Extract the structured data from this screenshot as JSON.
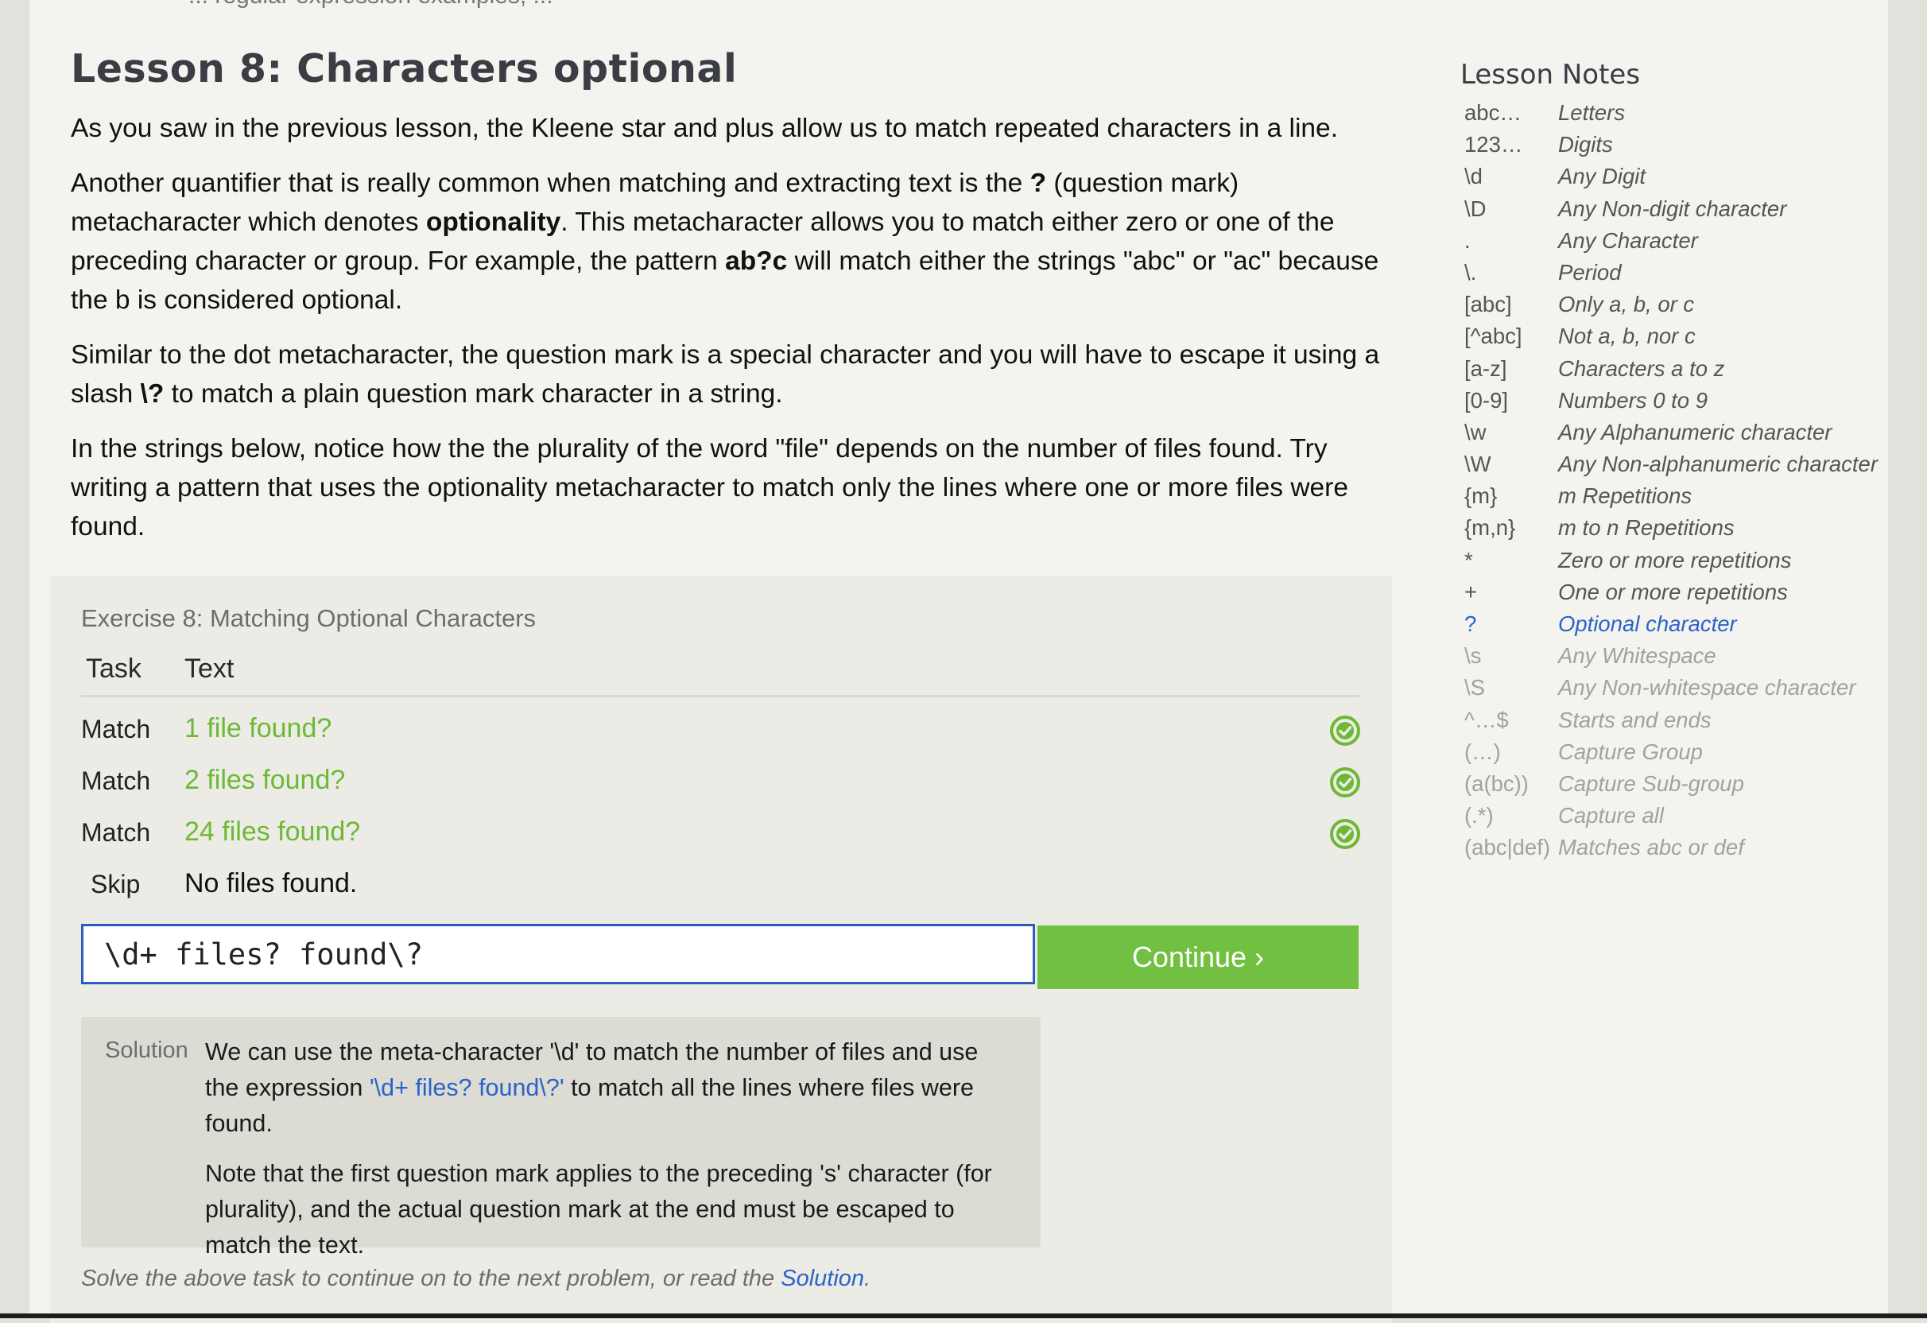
{
  "cutoff_text": "... regular expression examples; ...",
  "lesson": {
    "title": "Lesson 8: Characters optional",
    "p1": "As you saw in the previous lesson, the Kleene star and plus allow us to match repeated characters in a line.",
    "p2_a": "Another quantifier that is really common when matching and extracting text is the ",
    "p2_b": "?",
    "p2_c": " (question mark) metacharacter which denotes ",
    "p2_d": "optionality",
    "p2_e": ". This metacharacter allows you to match either zero or one of the preceding character or group. For example, the pattern ",
    "p2_f": "ab?c",
    "p2_g": " will match either the strings \"abc\" or \"ac\" because the b is considered optional.",
    "p3_a": "Similar to the dot metacharacter, the question mark is a special character and you will have to escape it using a slash ",
    "p3_b": "\\?",
    "p3_c": " to match a plain question mark character in a string.",
    "p4": "In the strings below, notice how the the plurality of the word \"file\" depends on the number of files found. Try writing a pattern that uses the optionality metacharacter to match only the lines where one or more files were found."
  },
  "exercise": {
    "title": "Exercise 8: Matching Optional Characters",
    "col_task": "Task",
    "col_text": "Text",
    "rows": [
      {
        "task": "Match",
        "text": "1 file found?",
        "status": "matched"
      },
      {
        "task": "Match",
        "text": "2 files found?",
        "status": "matched"
      },
      {
        "task": "Match",
        "text": "24 files found?",
        "status": "matched"
      },
      {
        "task": "Skip",
        "text": "No files found.",
        "status": "none"
      }
    ],
    "input_value": "\\d+ files? found\\?",
    "continue_label": "Continue",
    "continue_chevron": "›",
    "solution_label": "Solution",
    "solution_a": "We can use the meta-character '\\d' to match the number of files and use the expression ",
    "solution_code": "'\\d+ files? found\\?'",
    "solution_b": " to match all the lines where files were found.",
    "solution_p2": "Note that the first question mark applies to the preceding 's' character (for plurality), and the actual question mark at the end must be escaped to match the text.",
    "footer_a": "Solve the above task to continue on to the next problem, or read the ",
    "footer_link": "Solution",
    "footer_b": "."
  },
  "notes": {
    "title": "Lesson Notes",
    "items": [
      {
        "sym": "abc…",
        "desc": "Letters",
        "state": "normal"
      },
      {
        "sym": "123…",
        "desc": "Digits",
        "state": "normal"
      },
      {
        "sym": "\\d",
        "desc": "Any Digit",
        "state": "normal"
      },
      {
        "sym": "\\D",
        "desc": "Any Non-digit character",
        "state": "normal"
      },
      {
        "sym": ".",
        "desc": "Any Character",
        "state": "normal"
      },
      {
        "sym": "\\.",
        "desc": "Period",
        "state": "normal"
      },
      {
        "sym": "[abc]",
        "desc": "Only a, b, or c",
        "state": "normal"
      },
      {
        "sym": "[^abc]",
        "desc": "Not a, b, nor c",
        "state": "normal"
      },
      {
        "sym": "[a-z]",
        "desc": "Characters a to z",
        "state": "normal"
      },
      {
        "sym": "[0-9]",
        "desc": "Numbers 0 to 9",
        "state": "normal"
      },
      {
        "sym": "\\w",
        "desc": "Any Alphanumeric character",
        "state": "normal"
      },
      {
        "sym": "\\W",
        "desc": "Any Non-alphanumeric character",
        "state": "normal"
      },
      {
        "sym": "{m}",
        "desc": "m Repetitions",
        "state": "normal"
      },
      {
        "sym": "{m,n}",
        "desc": "m to n Repetitions",
        "state": "normal"
      },
      {
        "sym": "*",
        "desc": "Zero or more repetitions",
        "state": "normal"
      },
      {
        "sym": "+",
        "desc": "One or more repetitions",
        "state": "normal"
      },
      {
        "sym": "?",
        "desc": "Optional character",
        "state": "active"
      },
      {
        "sym": "\\s",
        "desc": "Any Whitespace",
        "state": "muted"
      },
      {
        "sym": "\\S",
        "desc": "Any Non-whitespace character",
        "state": "muted"
      },
      {
        "sym": "^…$",
        "desc": "Starts and ends",
        "state": "muted"
      },
      {
        "sym": "(…)",
        "desc": "Capture Group",
        "state": "muted"
      },
      {
        "sym": "(a(bc))",
        "desc": "Capture Sub-group",
        "state": "muted"
      },
      {
        "sym": "(.*)",
        "desc": "Capture all",
        "state": "muted"
      },
      {
        "sym": "(abc|def)",
        "desc": "Matches abc or def",
        "state": "muted"
      }
    ]
  },
  "colors": {
    "matched_text": "#6cb934",
    "accent_blue": "#2a64c8",
    "continue_bg": "#72c041"
  },
  "icons": {
    "row_status": "check-circle-icon"
  }
}
